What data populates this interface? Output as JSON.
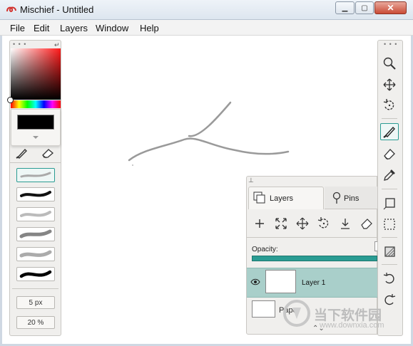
{
  "window": {
    "title": "Mischief - Untitled",
    "min_icon": "minimize-icon",
    "max_icon": "maximize-icon",
    "close_icon": "close-icon"
  },
  "menu": [
    "File",
    "Edit",
    "Layers",
    "Window",
    "Help"
  ],
  "left_panel": {
    "handle": "• • •",
    "current_color": "#000000",
    "tools": [
      "brush-icon",
      "eraser-icon"
    ],
    "brushes": [
      "pencil-brush",
      "marker-brush",
      "soft-brush",
      "airbrush-brush",
      "chalk-brush",
      "ink-brush"
    ],
    "brush_size": "5 px",
    "brush_opacity": "20 %"
  },
  "right_toolbar": {
    "handle": "• • •",
    "tools": [
      "zoom-icon",
      "pan-icon",
      "rotate-icon",
      "brush-icon",
      "eraser-icon",
      "eyedropper-icon",
      "shape-icon",
      "selection-icon",
      "fill-icon",
      "undo-icon",
      "redo-icon"
    ],
    "selected": "brush-icon"
  },
  "layers_panel": {
    "tab_layers": "Layers",
    "tab_pins": "Pins",
    "actions": [
      "add-layer-icon",
      "fit-icon",
      "move-icon",
      "rotate-icon",
      "flatten-icon",
      "eraser-icon"
    ],
    "opacity_label": "Opacity:",
    "opacity": 1.0,
    "layers": [
      {
        "name": "Layer 1",
        "visible": true,
        "selected": true
      },
      {
        "name": "Paper",
        "visible": true,
        "selected": false
      }
    ]
  },
  "watermark": {
    "text": "当下软件园",
    "url": "www.downxia.com"
  },
  "colors": {
    "accent": "#2a9c93",
    "selected_layer": "#a9cfca"
  }
}
